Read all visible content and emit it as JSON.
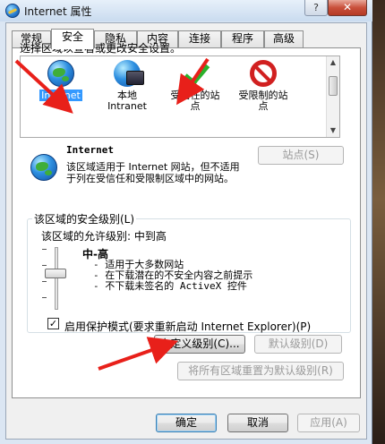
{
  "window": {
    "title": "Internet 属性",
    "help_label": "?",
    "close_label": "✕"
  },
  "tabs": [
    {
      "label": "常规"
    },
    {
      "label": "安全"
    },
    {
      "label": "隐私"
    },
    {
      "label": "内容"
    },
    {
      "label": "连接"
    },
    {
      "label": "程序"
    },
    {
      "label": "高级"
    }
  ],
  "active_tab": "安全",
  "security": {
    "instruction": "选择区域以查看或更改安全设置。",
    "zones": [
      {
        "label_line1": "Internet",
        "label_line2": "",
        "icon": "globe-icon",
        "selected": true
      },
      {
        "label_line1": "本地",
        "label_line2": "Intranet",
        "icon": "intranet-icon",
        "selected": false
      },
      {
        "label_line1": "受信任的站",
        "label_line2": "点",
        "icon": "check-icon",
        "selected": false
      },
      {
        "label_line1": "受限制的站",
        "label_line2": "点",
        "icon": "no-entry-icon",
        "selected": false
      }
    ],
    "selected_zone_name": "Internet",
    "selected_zone_desc": "该区域适用于 Internet 网站，但不适用于列在受信任和受限制区域中的网站。",
    "sites_button": "站点(S)",
    "level_group_title": "该区域的安全级别(L)",
    "allowed_levels": "该区域的允许级别: 中到高",
    "level_name": "中-高",
    "level_points": [
      "- 适用于大多数网站",
      "- 在下载潜在的不安全内容之前提示",
      "- 不下载未签名的 ActiveX 控件"
    ],
    "protected_mode_checked": true,
    "protected_mode_label": "启用保护模式(要求重新启动 Internet Explorer)(P)",
    "custom_level_button": "自定义级别(C)...",
    "default_level_button": "默认级别(D)",
    "reset_all_button": "将所有区域重置为默认级别(R)"
  },
  "footer": {
    "ok": "确定",
    "cancel": "取消",
    "apply": "应用(A)"
  },
  "colors": {
    "arrow": "#e8201a",
    "selection": "#3399ff"
  }
}
